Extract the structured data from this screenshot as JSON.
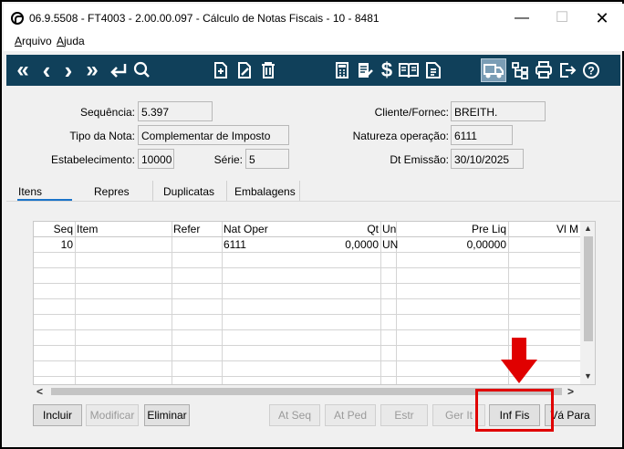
{
  "window": {
    "title": "06.9.5508 - FT4003 - 2.00.00.097 - Cálculo de Notas Fiscais - 10 - 8481",
    "min_glyph": "—",
    "max_glyph": "☐",
    "close_glyph": "✕"
  },
  "menu": {
    "file": "rquivo",
    "file_mnemonic": "A",
    "help": "juda",
    "help_mnemonic": "A"
  },
  "toolbar": {
    "icons": [
      "first-icon",
      "prev-icon",
      "next-icon",
      "last-icon",
      "return-icon",
      "search-icon",
      "new-doc-icon",
      "edit-doc-icon",
      "delete-icon",
      "calculator-icon",
      "report-icon",
      "currency-icon",
      "book-icon",
      "document-icon",
      "truck-icon",
      "tree-icon",
      "print-icon",
      "exit-icon",
      "help-icon"
    ],
    "glyphs": {
      "first": "«",
      "prev": "‹",
      "next": "›",
      "last": "»",
      "currency": "$",
      "help": "?"
    },
    "background": "#10405a"
  },
  "form": {
    "sequencia_label": "Sequência:",
    "sequencia": "5.397",
    "tipo_label": "Tipo da Nota:",
    "tipo": "Complementar de Imposto",
    "estab_label": "Estabelecimento:",
    "estab": "10000",
    "serie_label": "Série:",
    "serie": "5",
    "cliente_label": "Cliente/Fornec:",
    "cliente": "BREITH.",
    "natureza_label": "Natureza operação:",
    "natureza": "6111",
    "emissao_label": "Dt Emissão:",
    "emissao": "30/10/2025"
  },
  "tabs": [
    "Itens",
    "Repres",
    "Duplicatas",
    "Embalagens"
  ],
  "grid": {
    "headers": {
      "seq": "Seq",
      "item": "Item",
      "refer": "Refer",
      "nat": "Nat Oper",
      "qt": "Qt",
      "un": "Un",
      "preliq": "Pre Liq",
      "vlm": "Vl M"
    },
    "rows": [
      {
        "seq": "10",
        "item": "",
        "refer": "",
        "nat": "6111",
        "qt": "0,0000",
        "un": "UN",
        "preliq": "0,00000",
        "vlm": ""
      }
    ],
    "scroll": {
      "up": "▲",
      "down": "▼",
      "left": "<",
      "right": ">"
    }
  },
  "buttons": {
    "incluir": "Incluir",
    "modificar": "Modificar",
    "eliminar": "Eliminar",
    "atseq": "At Seq",
    "atped": "At Ped",
    "estr": "Estr",
    "gerit": "Ger It",
    "inffis": "Inf Fis",
    "vapara": "Vá Para"
  },
  "annotation": {
    "color": "#e00000"
  }
}
